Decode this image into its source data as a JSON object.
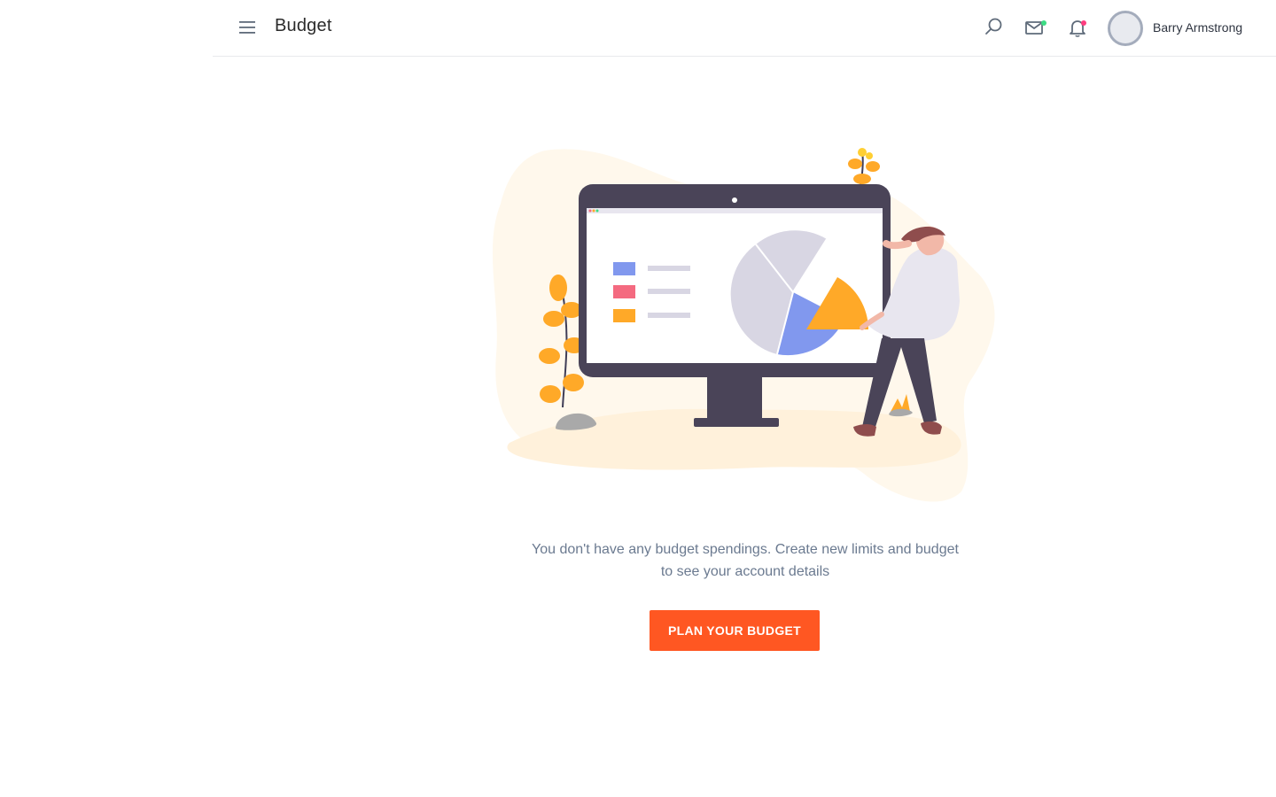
{
  "header": {
    "title": "Budget",
    "user_name": "Barry Armstrong",
    "icons": {
      "menu": "menu-icon",
      "search": "search-icon",
      "mail": "mail-icon",
      "notifications": "bell-icon"
    },
    "indicator_colors": {
      "mail": "#3ddc84",
      "notifications": "#ff3d7f"
    }
  },
  "empty_state": {
    "message": "You don't have any budget spendings. Create new limits and budget to see your account details",
    "button_label": "PLAN YOUR BUDGET"
  },
  "colors": {
    "accent": "#ff5722",
    "illustration_orange": "#ffa928",
    "illustration_blue": "#8198ee",
    "illustration_red": "#f46a80",
    "monitor": "#4a4458"
  }
}
